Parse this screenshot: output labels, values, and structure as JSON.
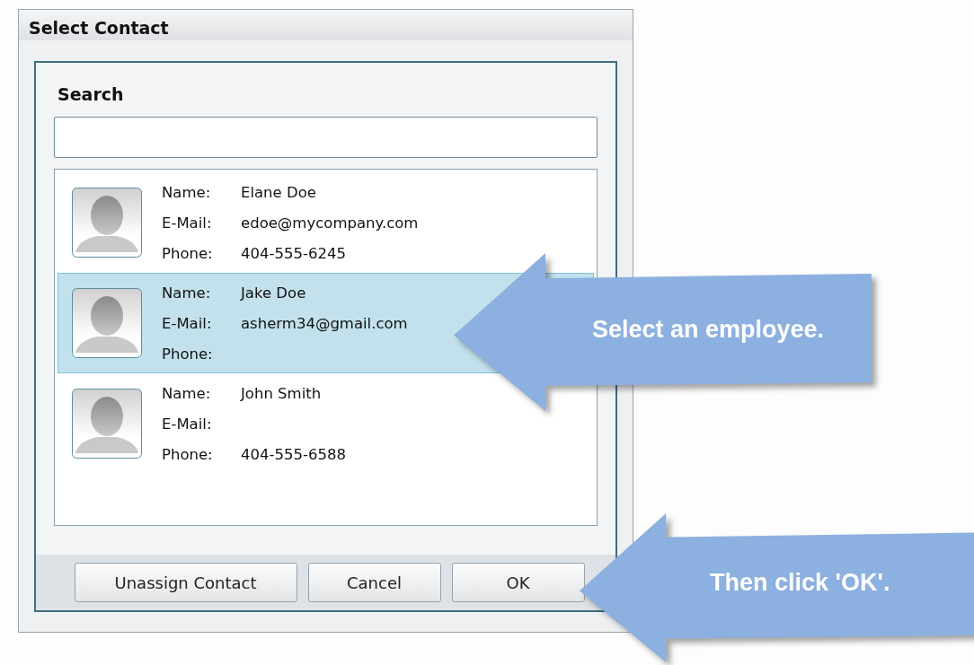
{
  "window": {
    "title": "Select Contact"
  },
  "search": {
    "label": "Search"
  },
  "contacts": [
    {
      "selected": false,
      "fields": [
        {
          "label": "Name:",
          "value": "Elane Doe"
        },
        {
          "label": "E-Mail:",
          "value": "edoe@mycompany.com"
        },
        {
          "label": "Phone:",
          "value": "404-555-6245"
        }
      ]
    },
    {
      "selected": true,
      "fields": [
        {
          "label": "Name:",
          "value": "Jake Doe"
        },
        {
          "label": "E-Mail:",
          "value": "asherm34@gmail.com"
        },
        {
          "label": "Phone:"
        }
      ]
    },
    {
      "selected": false,
      "fields": [
        {
          "label": "Name:",
          "value": "John Smith"
        },
        {
          "label": "E-Mail:"
        },
        {
          "label": "Phone:",
          "value": "404-555-6588"
        }
      ]
    }
  ],
  "buttons": [
    "Unassign Contact",
    "Cancel",
    "OK"
  ],
  "callouts": [
    {
      "text": "Select an employee."
    },
    {
      "text": "Then click 'OK'."
    }
  ]
}
